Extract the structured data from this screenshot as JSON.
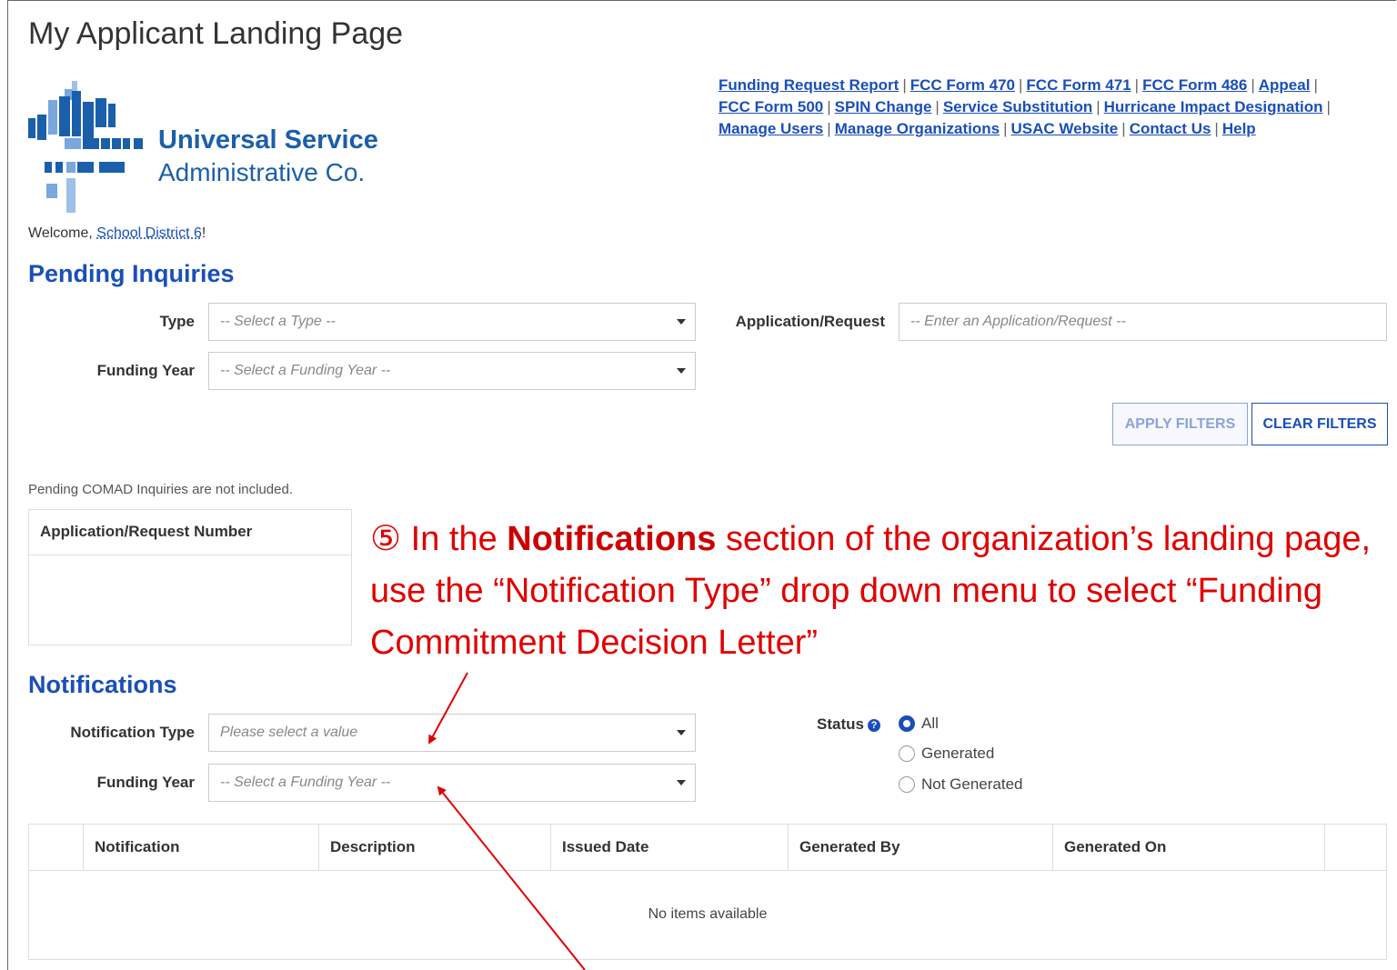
{
  "page": {
    "title": "My Applicant Landing Page"
  },
  "logo": {
    "line1": "Universal Service",
    "line2": "Administrative Co."
  },
  "topnav": [
    "Funding Request Report",
    "FCC Form 470",
    "FCC Form 471",
    "FCC Form 486",
    "Appeal",
    "FCC Form 500",
    "SPIN Change",
    "Service Substitution",
    "Hurricane Impact Designation",
    "Manage Users",
    "Manage Organizations",
    "USAC Website",
    "Contact Us",
    "Help"
  ],
  "welcome": {
    "prefix": "Welcome, ",
    "org": "School District 6",
    "suffix": "!"
  },
  "pending": {
    "heading": "Pending Inquiries",
    "type_label": "Type",
    "type_placeholder": "-- Select a Type --",
    "app_label": "Application/Request",
    "app_placeholder": "-- Enter an Application/Request --",
    "fy_label": "Funding Year",
    "fy_placeholder": "-- Select a Funding Year --",
    "apply_label": "APPLY FILTERS",
    "clear_label": "CLEAR FILTERS",
    "note": "Pending COMAD Inquiries are not included.",
    "table_header": "Application/Request Number"
  },
  "annotation": {
    "marker": "⑤",
    "pre": " In the ",
    "bold": "Notifications",
    "post": " section of the organization’s landing page, use the “Notification Type” drop down menu to select “Funding Commitment Decision Letter”"
  },
  "notifications": {
    "heading": "Notifications",
    "type_label": "Notification Type",
    "type_placeholder": "Please select a value",
    "fy_label": "Funding Year",
    "fy_placeholder": "-- Select a Funding Year --",
    "status_label": "Status",
    "status_options": [
      "All",
      "Generated",
      "Not Generated"
    ],
    "status_selected": "All",
    "columns": [
      "Notification",
      "Description",
      "Issued Date",
      "Generated By",
      "Generated On"
    ],
    "empty_text": "No items available"
  },
  "colors": {
    "link": "#1a4fb8",
    "annotation": "#e00000"
  }
}
